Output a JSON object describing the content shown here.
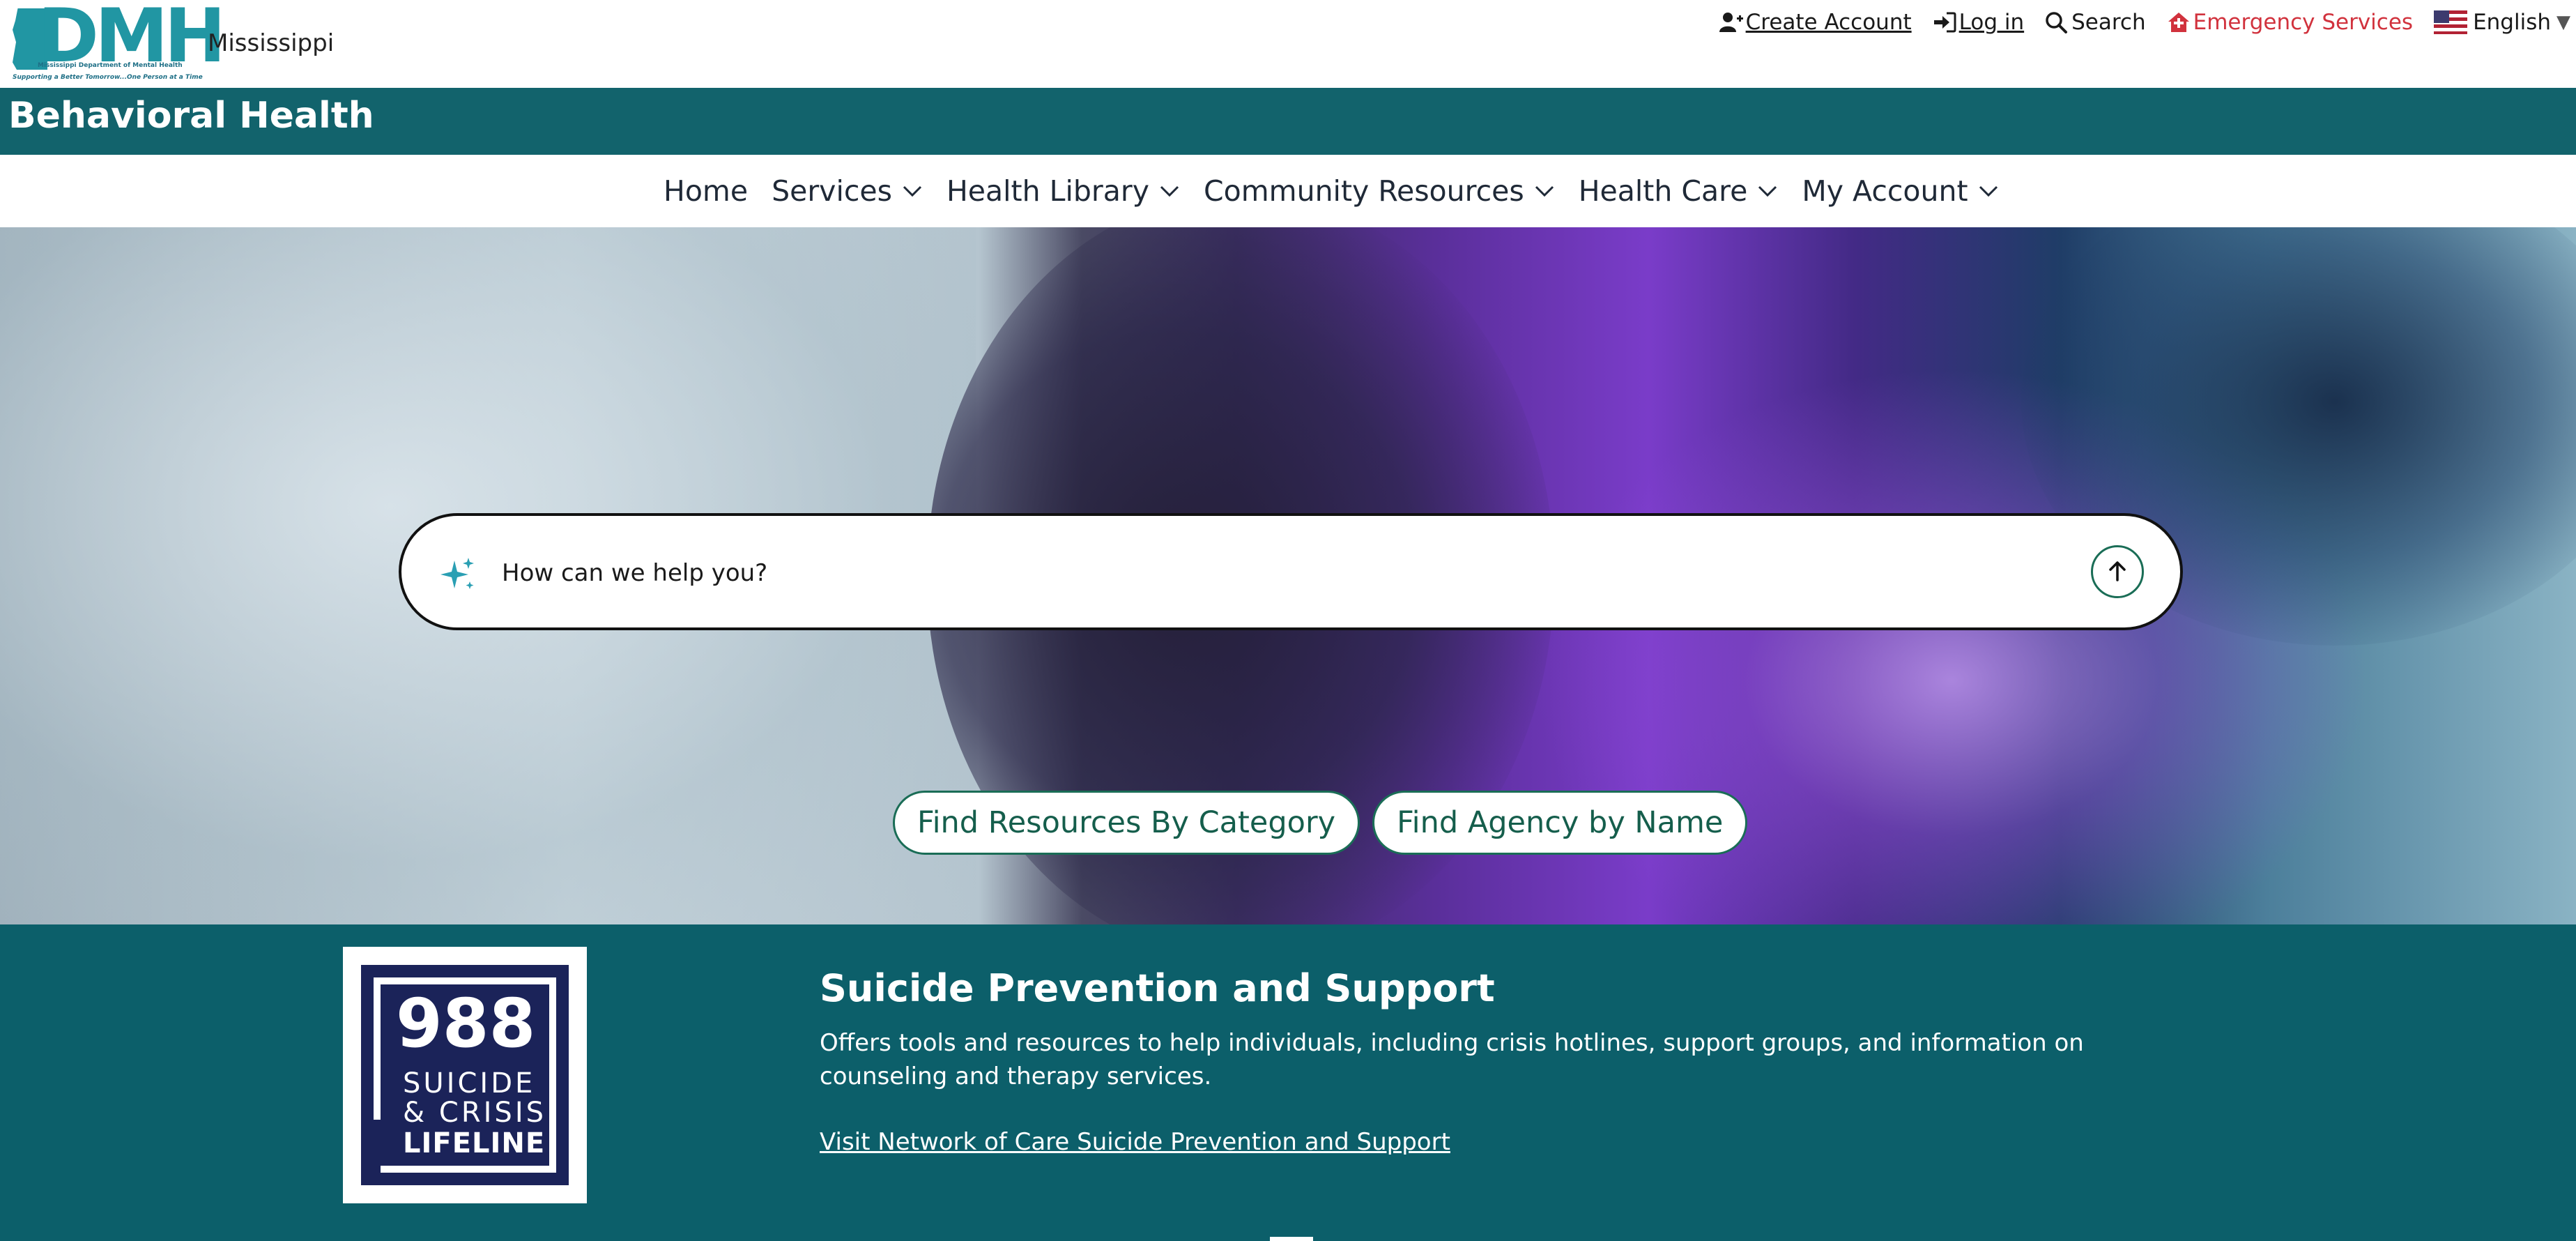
{
  "header": {
    "logo_text": "DMH",
    "logo_subtitle": "Mississippi Department of Mental Health",
    "logo_tagline": "Supporting a Better Tomorrow...One Person at a Time",
    "state_name": "Mississippi",
    "utility_nav": {
      "create_account": "Create Account",
      "log_in": "Log in",
      "search": "Search",
      "emergency_services": "Emergency Services",
      "language": "English"
    }
  },
  "banner": {
    "title": "Behavioral Health"
  },
  "main_nav": {
    "items": [
      {
        "label": "Home",
        "has_dropdown": false
      },
      {
        "label": "Services",
        "has_dropdown": true
      },
      {
        "label": "Health Library",
        "has_dropdown": true
      },
      {
        "label": "Community Resources",
        "has_dropdown": true
      },
      {
        "label": "Health Care",
        "has_dropdown": true
      },
      {
        "label": "My Account",
        "has_dropdown": true
      }
    ]
  },
  "hero": {
    "search": {
      "placeholder": "How can we help you?",
      "value": ""
    },
    "buttons": {
      "by_category": "Find Resources By Category",
      "by_name": "Find Agency by Name"
    }
  },
  "support": {
    "logo": {
      "number": "988",
      "line1": "SUICIDE",
      "line2": "& CRISIS",
      "line3": "LIFELINE"
    },
    "title": "Suicide Prevention and Support",
    "description": "Offers tools and resources to help individuals, including crisis hotlines, support groups, and information on counseling and therapy services.",
    "link": "Visit Network of Care Suicide Prevention and Support"
  },
  "colors": {
    "brand_teal": "#12636c",
    "section_teal": "#0c5f6a",
    "logo_teal": "#2196a3",
    "button_green": "#1a6d56",
    "emergency_red": "#d1323d",
    "lifeline_navy": "#1b2359"
  },
  "icons": {
    "create_account": "user-plus-icon",
    "log_in": "sign-in-icon",
    "search": "search-icon",
    "emergency": "emergency-house-icon",
    "language": "us-flag-icon",
    "ai_search": "sparkle-icon",
    "submit": "arrow-up-icon",
    "dropdown": "chevron-down-icon"
  }
}
